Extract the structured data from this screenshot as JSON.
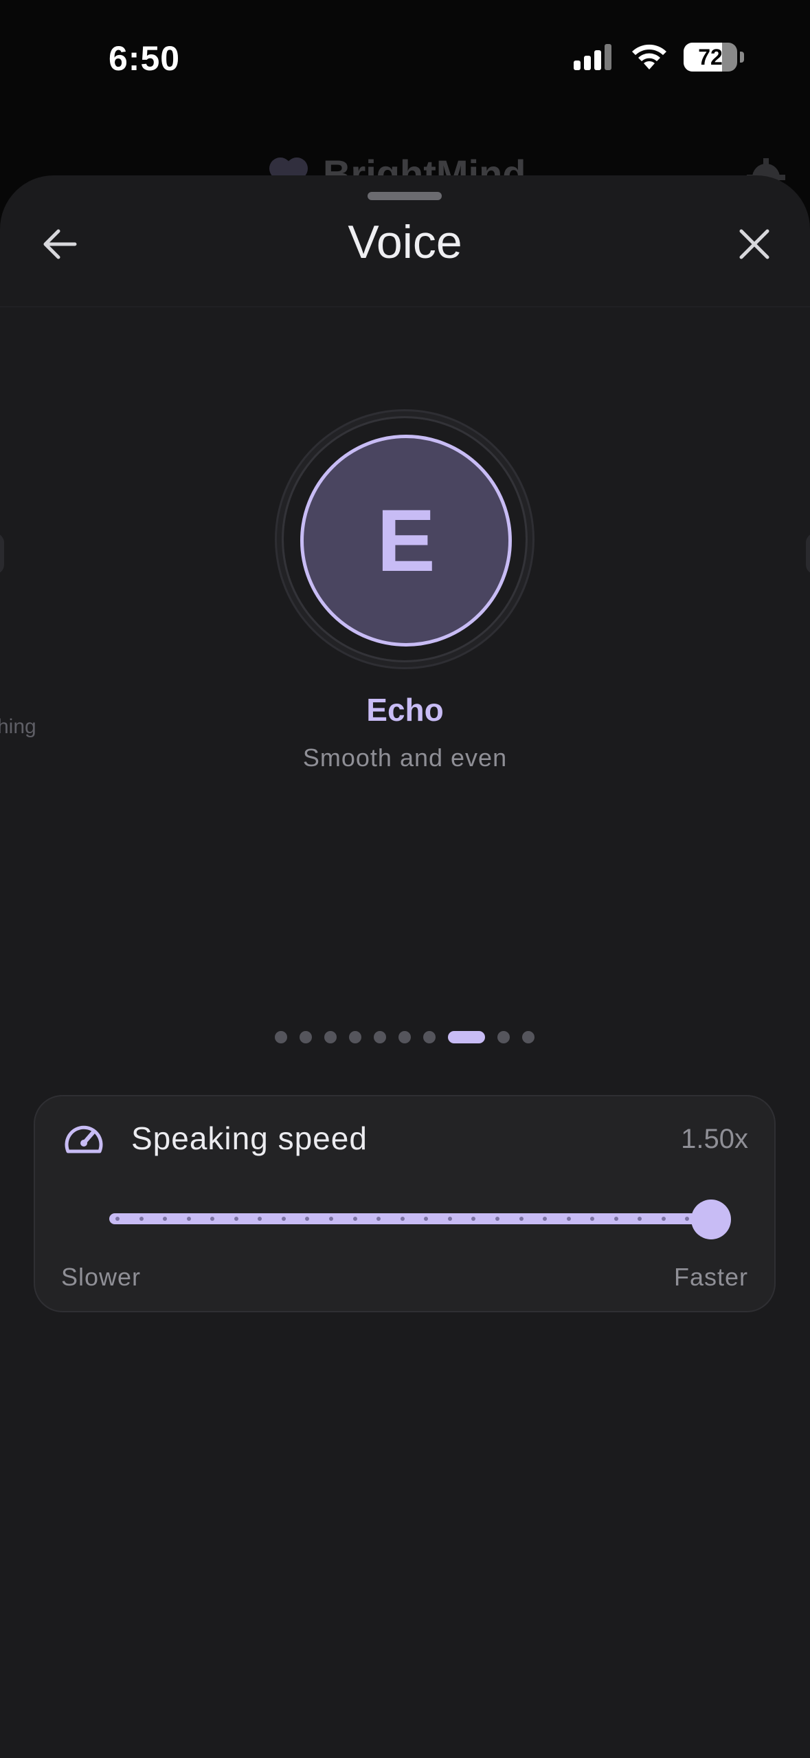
{
  "status_bar": {
    "time": "6:50",
    "battery": "72",
    "battery_level": 0.72
  },
  "background_app": {
    "title": "BrightMind"
  },
  "sheet": {
    "title": "Voice"
  },
  "voice": {
    "initial": "E",
    "name": "Echo",
    "description": "Smooth and even",
    "peek_prev_label": "hing",
    "carousel_count": 10,
    "carousel_active_index": 7
  },
  "speed": {
    "label": "Speaking speed",
    "value_label": "1.50x",
    "value": 1.5,
    "min": 0.5,
    "max": 1.5,
    "steps": 25,
    "min_label": "Slower",
    "max_label": "Faster"
  },
  "colors": {
    "accent": "#c8bcf5",
    "sheet_bg": "#1b1b1d",
    "card_bg": "#232325",
    "avatar_bg": "#4a4560"
  },
  "icons": {
    "back": "arrow-left-icon",
    "close": "close-icon",
    "speed": "speedometer-icon"
  }
}
